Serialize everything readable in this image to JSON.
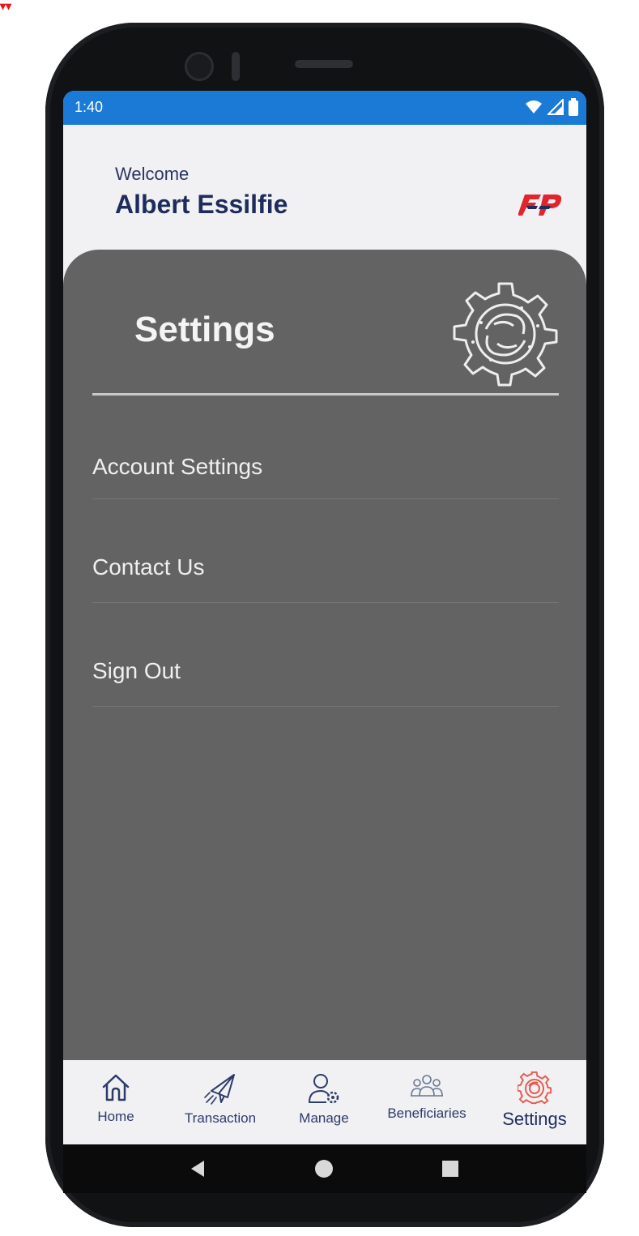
{
  "status_bar": {
    "time": "1:40",
    "color": "#1a7ad6",
    "icons": [
      "wifi-icon",
      "signal-icon",
      "battery-icon"
    ]
  },
  "header": {
    "greeting": "Welcome",
    "user_name": "Albert Essilfie",
    "logo": "FP"
  },
  "settings_panel": {
    "title": "Settings",
    "icon": "gear-icon",
    "background": "#636363",
    "items": [
      {
        "label": "Account Settings"
      },
      {
        "label": "Contact Us"
      },
      {
        "label": "Sign Out"
      }
    ]
  },
  "bottom_nav": {
    "active": "Settings",
    "active_color": "#e85a4f",
    "items": [
      {
        "label": "Home",
        "icon": "home-icon"
      },
      {
        "label": "Transaction",
        "icon": "paper-plane-icon"
      },
      {
        "label": "Manage",
        "icon": "user-gear-icon"
      },
      {
        "label": "Beneficiaries",
        "icon": "group-icon"
      },
      {
        "label": "Settings",
        "icon": "gear-icon"
      }
    ]
  },
  "android_nav": {
    "icons": [
      "back-icon",
      "home-circle-icon",
      "recents-icon"
    ]
  }
}
